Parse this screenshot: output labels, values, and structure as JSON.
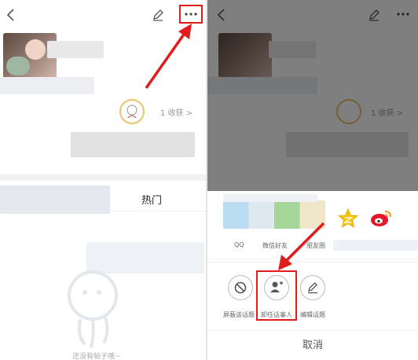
{
  "left_panel": {
    "harvest_text": "1 收获 >",
    "tab_hot": "热门",
    "empty_text": "还没有帖子哦~"
  },
  "right_panel": {
    "harvest_text": "1 收获 >",
    "share_labels": [
      "QQ",
      "微信好友",
      "朋友圈"
    ],
    "actions": [
      {
        "label": "屏蔽该话题",
        "icon": "block-icon"
      },
      {
        "label": "卸任话事人",
        "icon": "remove-moderator-icon"
      },
      {
        "label": "编辑话题",
        "icon": "edit-icon"
      }
    ],
    "cancel_label": "取消"
  },
  "colors": {
    "annotation_red": "#e21b1b",
    "qzone_yellow": "#f6c500",
    "weibo_red": "#e6162d",
    "overlay": "rgba(0,0,0,0.5)"
  }
}
